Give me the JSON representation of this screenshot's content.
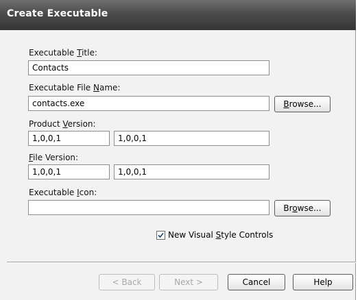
{
  "dialog": {
    "title": "Create Executable"
  },
  "fields": {
    "exec_title": {
      "label_pre": "Executable ",
      "label_key": "T",
      "label_post": "itle:",
      "value": "Contacts"
    },
    "exec_file_name": {
      "label_pre": "Executable File ",
      "label_key": "N",
      "label_post": "ame:",
      "value": "contacts.exe",
      "browse_pre": "",
      "browse_key": "B",
      "browse_post": "rowse..."
    },
    "product_version": {
      "label_pre": "Product ",
      "label_key": "V",
      "label_post": "ersion:",
      "value1": "1,0,0,1",
      "value2": "1,0,0,1"
    },
    "file_version": {
      "label_pre": "",
      "label_key": "F",
      "label_post": "ile Version:",
      "value1": "1,0,0,1",
      "value2": "1,0,0,1"
    },
    "exec_icon": {
      "label_pre": "Executable ",
      "label_key": "I",
      "label_post": "con:",
      "value": "",
      "browse_pre": "Br",
      "browse_key": "o",
      "browse_post": "wse..."
    }
  },
  "checkbox": {
    "checked": true,
    "label_pre": "New Visual ",
    "label_key": "S",
    "label_post": "tyle Controls"
  },
  "buttons": {
    "back": "< Back",
    "next": "Next >",
    "cancel": "Cancel",
    "help": "Help"
  }
}
